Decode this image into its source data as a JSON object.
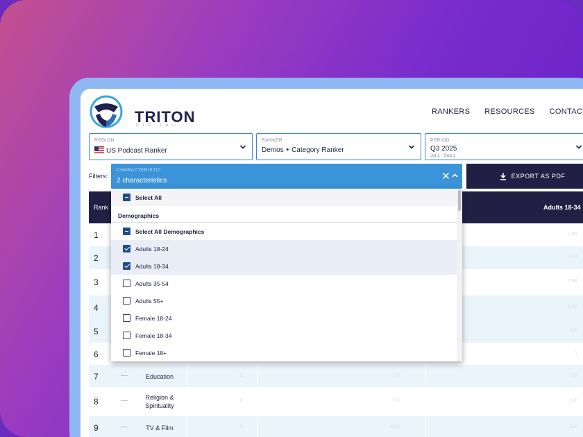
{
  "brand": {
    "name": "TRITON",
    "sub": "DIGITAL"
  },
  "nav": [
    "RANKERS",
    "RESOURCES",
    "CONTACT US"
  ],
  "selectors": {
    "region": {
      "label": "REGION",
      "value": "US Podcast Ranker"
    },
    "ranker": {
      "label": "RANKER",
      "value": "Demos + Category Ranker"
    },
    "period": {
      "label": "PERIOD",
      "value": "Q3 2025",
      "sub": "Jul 1 - Sep 1"
    }
  },
  "filters": {
    "label": "Filters:",
    "characteristic": {
      "label": "CHARACTERISTIC",
      "value": "2 characteristics"
    }
  },
  "export_label": "EXPORT AS PDF",
  "table": {
    "headers": {
      "rank": "Rank",
      "adults": "Adults 18-34"
    },
    "rows": [
      {
        "rank": "1",
        "category": ""
      },
      {
        "rank": "2",
        "category": ""
      },
      {
        "rank": "3",
        "category": ""
      },
      {
        "rank": "4",
        "category": ""
      },
      {
        "rank": "5",
        "category": ""
      },
      {
        "rank": "6",
        "category": ""
      },
      {
        "rank": "7",
        "dash": "—",
        "category": "Education"
      },
      {
        "rank": "8",
        "dash": "—",
        "category": "Religion & Spirituality"
      },
      {
        "rank": "9",
        "dash": "—",
        "category": "TV & Film"
      }
    ]
  },
  "dropdown": {
    "select_all": "Select All",
    "group": "Demographics",
    "select_all_group": "Select All Demographics",
    "options": [
      {
        "label": "Adults 18-24",
        "checked": true
      },
      {
        "label": "Adults 18-34",
        "checked": true
      },
      {
        "label": "Adults 35-54",
        "checked": false
      },
      {
        "label": "Adults 55+",
        "checked": false
      },
      {
        "label": "Female 18-24",
        "checked": false
      },
      {
        "label": "Female 18-34",
        "checked": false
      },
      {
        "label": "Female 18+",
        "checked": false
      }
    ]
  },
  "colors": {
    "navy": "#212044",
    "accent_blue": "#3b93d9",
    "border_blue": "#3b7fd6",
    "row_alt": "#eaf5fb",
    "selected_row": "#e9eef6"
  }
}
